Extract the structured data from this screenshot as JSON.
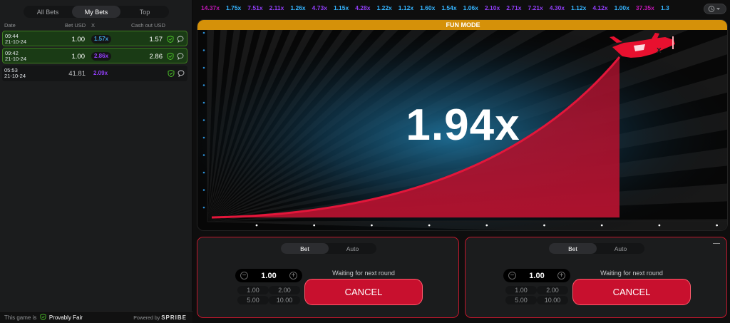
{
  "left": {
    "tabs": [
      {
        "label": "All Bets"
      },
      {
        "label": "My Bets"
      },
      {
        "label": "Top"
      }
    ],
    "headers": {
      "date": "Date",
      "bet": "Bet USD",
      "x": "X",
      "cashout": "Cash out USD"
    },
    "rows": [
      {
        "time": "09:44",
        "date": "21-10-24",
        "bet": "1.00",
        "mult": "1.57x",
        "mult_color": "#3ea3de",
        "cashout": "1.57",
        "status": "win"
      },
      {
        "time": "09:42",
        "date": "21-10-24",
        "bet": "1.00",
        "mult": "2.86x",
        "mult_color": "#913ef8",
        "cashout": "2.86",
        "status": "win"
      },
      {
        "time": "05:53",
        "date": "21-10-24",
        "bet": "41.81",
        "mult": "2.09x",
        "mult_color": "#913ef8",
        "cashout": "",
        "status": "lost"
      }
    ],
    "footer": {
      "prefix": "This game is",
      "provably": "Provably Fair",
      "powered": "Powered by",
      "brand": "SPRIBE"
    }
  },
  "history": [
    {
      "v": "14.37x",
      "c": "#c017b4"
    },
    {
      "v": "1.75x",
      "c": "#34b4ff"
    },
    {
      "v": "7.51x",
      "c": "#913ef8"
    },
    {
      "v": "2.11x",
      "c": "#913ef8"
    },
    {
      "v": "1.26x",
      "c": "#34b4ff"
    },
    {
      "v": "4.73x",
      "c": "#913ef8"
    },
    {
      "v": "1.15x",
      "c": "#34b4ff"
    },
    {
      "v": "4.28x",
      "c": "#913ef8"
    },
    {
      "v": "1.22x",
      "c": "#34b4ff"
    },
    {
      "v": "1.12x",
      "c": "#34b4ff"
    },
    {
      "v": "1.60x",
      "c": "#34b4ff"
    },
    {
      "v": "1.54x",
      "c": "#34b4ff"
    },
    {
      "v": "1.06x",
      "c": "#34b4ff"
    },
    {
      "v": "2.10x",
      "c": "#913ef8"
    },
    {
      "v": "2.71x",
      "c": "#913ef8"
    },
    {
      "v": "7.21x",
      "c": "#913ef8"
    },
    {
      "v": "4.30x",
      "c": "#913ef8"
    },
    {
      "v": "1.12x",
      "c": "#34b4ff"
    },
    {
      "v": "4.12x",
      "c": "#913ef8"
    },
    {
      "v": "1.00x",
      "c": "#34b4ff"
    },
    {
      "v": "37.35x",
      "c": "#c017b4"
    },
    {
      "v": "1.3",
      "c": "#34b4ff"
    }
  ],
  "game": {
    "mode_label": "FUN MODE",
    "multiplier": "1.94x",
    "plane_icon": "airplane-icon",
    "history_icon": "history-clock-icon"
  },
  "bet_panels": [
    {
      "tabs": [
        {
          "label": "Bet"
        },
        {
          "label": "Auto"
        }
      ],
      "amount": "1.00",
      "quick": [
        "1.00",
        "2.00",
        "5.00",
        "10.00"
      ],
      "waiting": "Waiting for next round",
      "cancel": "CANCEL"
    },
    {
      "tabs": [
        {
          "label": "Bet"
        },
        {
          "label": "Auto"
        }
      ],
      "amount": "1.00",
      "quick": [
        "1.00",
        "2.00",
        "5.00",
        "10.00"
      ],
      "waiting": "Waiting for next round",
      "cancel": "CANCEL"
    }
  ],
  "colors": {
    "accent": "#c8102e",
    "win_bg": "#1a3b15",
    "mode_bar": "#d59109",
    "curve": "#e3163a"
  }
}
